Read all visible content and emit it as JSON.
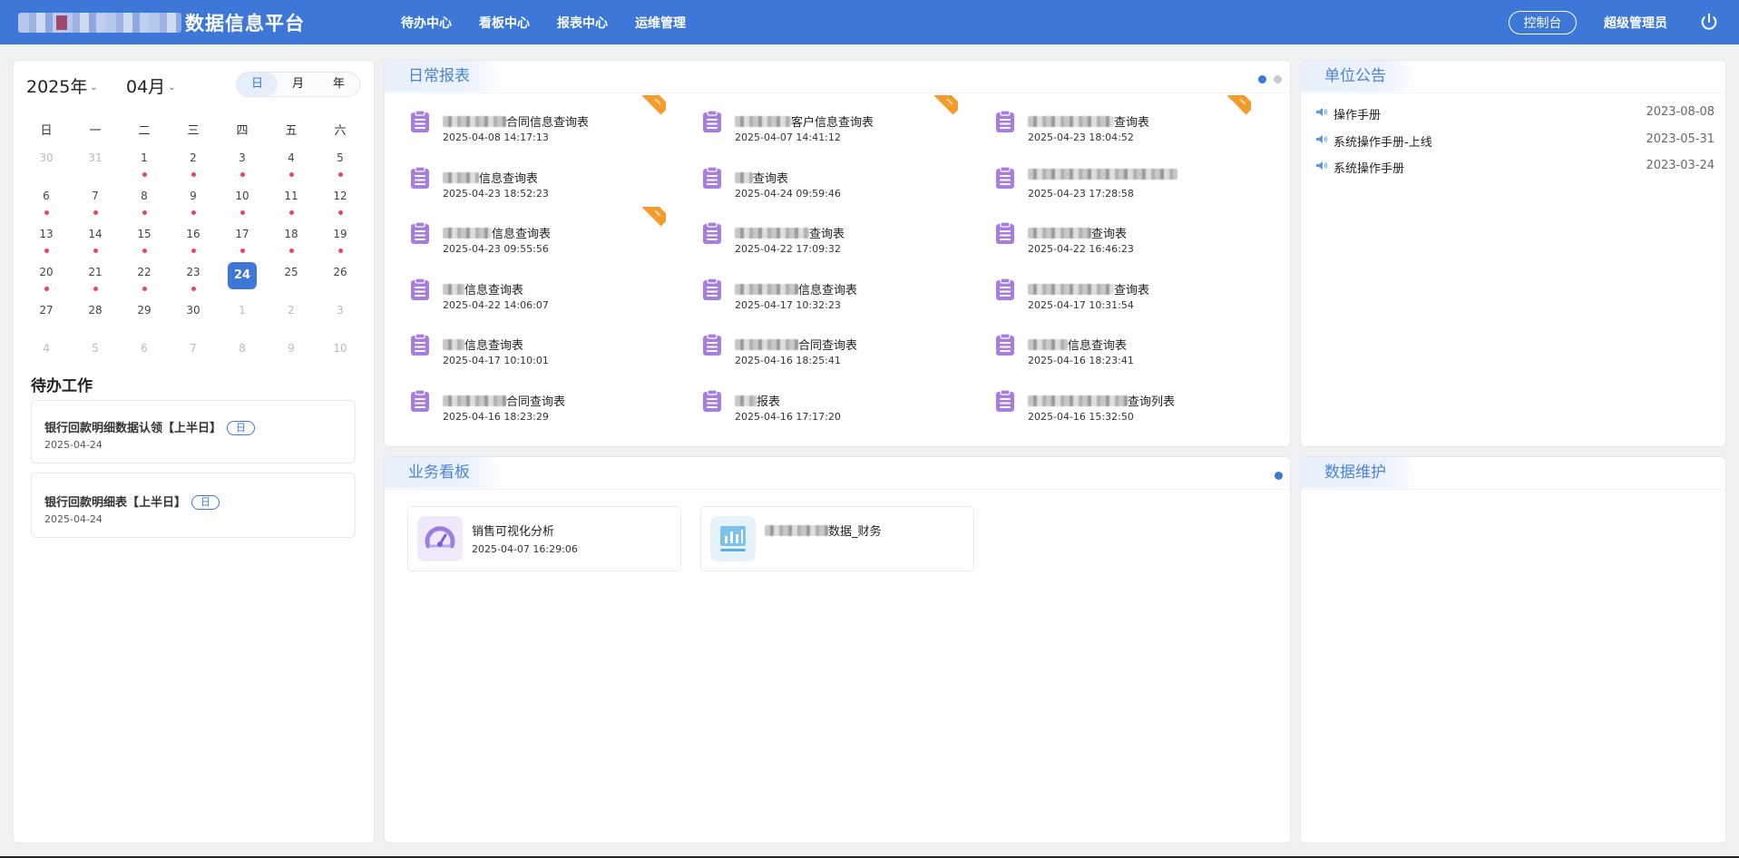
{
  "header": {
    "brand_text": "数据信息平台",
    "nav": [
      "待办中心",
      "看板中心",
      "报表中心",
      "运维管理"
    ],
    "console_label": "控制台",
    "user": "超级管理员",
    "accent": "#3d78d8"
  },
  "calendar": {
    "year": "2025年",
    "month": "04月",
    "views": [
      "日",
      "月",
      "年"
    ],
    "active_view": "日",
    "weekdays": [
      "日",
      "一",
      "二",
      "三",
      "四",
      "五",
      "六"
    ],
    "days": [
      {
        "n": "30",
        "muted": true,
        "dot": false
      },
      {
        "n": "31",
        "muted": true,
        "dot": false
      },
      {
        "n": "1",
        "dot": true
      },
      {
        "n": "2",
        "dot": true
      },
      {
        "n": "3",
        "dot": true
      },
      {
        "n": "4",
        "dot": true
      },
      {
        "n": "5",
        "dot": true
      },
      {
        "n": "6",
        "dot": true
      },
      {
        "n": "7",
        "dot": true
      },
      {
        "n": "8",
        "dot": true
      },
      {
        "n": "9",
        "dot": true
      },
      {
        "n": "10",
        "dot": true
      },
      {
        "n": "11",
        "dot": true
      },
      {
        "n": "12",
        "dot": true
      },
      {
        "n": "13",
        "dot": true
      },
      {
        "n": "14",
        "dot": true
      },
      {
        "n": "15",
        "dot": true
      },
      {
        "n": "16",
        "dot": true
      },
      {
        "n": "17",
        "dot": true
      },
      {
        "n": "18",
        "dot": true
      },
      {
        "n": "19",
        "dot": true
      },
      {
        "n": "20",
        "dot": true
      },
      {
        "n": "21",
        "dot": true
      },
      {
        "n": "22",
        "dot": true
      },
      {
        "n": "23",
        "dot": true
      },
      {
        "n": "24",
        "dot": false,
        "today": true
      },
      {
        "n": "25",
        "dot": false
      },
      {
        "n": "26",
        "dot": false
      },
      {
        "n": "27",
        "dot": false
      },
      {
        "n": "28",
        "dot": false
      },
      {
        "n": "29",
        "dot": false
      },
      {
        "n": "30",
        "dot": false
      },
      {
        "n": "1",
        "muted": true
      },
      {
        "n": "2",
        "muted": true
      },
      {
        "n": "3",
        "muted": true
      },
      {
        "n": "4",
        "muted": true
      },
      {
        "n": "5",
        "muted": true
      },
      {
        "n": "6",
        "muted": true
      },
      {
        "n": "7",
        "muted": true
      },
      {
        "n": "8",
        "muted": true
      },
      {
        "n": "9",
        "muted": true
      },
      {
        "n": "10",
        "muted": true
      }
    ]
  },
  "todo": {
    "title": "待办工作",
    "items": [
      {
        "title": "银行回款明细数据认领【上半日】",
        "tag": "日",
        "date": "2025-04-24"
      },
      {
        "title": "银行回款明细表【上半日】",
        "tag": "日",
        "date": "2025-04-24"
      }
    ]
  },
  "daily_reports": {
    "title": "日常报表",
    "items": [
      {
        "suffix": "合同信息查询表",
        "blur": 70,
        "date": "2025-04-08 14:17:13",
        "new": true
      },
      {
        "suffix": "客户信息查询表",
        "blur": 62,
        "date": "2025-04-07 14:41:12",
        "new": true
      },
      {
        "suffix": "查询表",
        "blur": 95,
        "date": "2025-04-23 18:04:52",
        "new": true
      },
      {
        "suffix": "信息查询表",
        "blur": 40,
        "date": "2025-04-23 18:52:23",
        "new": true
      },
      {
        "suffix": "查询表",
        "blur": 20,
        "date": "2025-04-24 09:59:46",
        "new": false
      },
      {
        "suffix": "",
        "blur": 165,
        "date": "2025-04-23 17:28:58",
        "new": false
      },
      {
        "suffix": "信息查询表",
        "blur": 54,
        "date": "2025-04-23 09:55:56",
        "new": false
      },
      {
        "suffix": "查询表",
        "blur": 82,
        "date": "2025-04-22 17:09:32",
        "new": false
      },
      {
        "suffix": "查询表",
        "blur": 70,
        "date": "2025-04-22 16:46:23",
        "new": false
      },
      {
        "suffix": "信息查询表",
        "blur": 24,
        "date": "2025-04-22 14:06:07",
        "new": false
      },
      {
        "suffix": "信息查询表",
        "blur": 70,
        "date": "2025-04-17 10:32:23",
        "new": false
      },
      {
        "suffix": "查询表",
        "blur": 95,
        "date": "2025-04-17 10:31:54",
        "new": false
      },
      {
        "suffix": "信息查询表",
        "blur": 24,
        "date": "2025-04-17 10:10:01",
        "new": false
      },
      {
        "suffix": "合同查询表",
        "blur": 70,
        "date": "2025-04-16 18:25:41",
        "new": false
      },
      {
        "suffix": "信息查询表",
        "blur": 44,
        "date": "2025-04-16 18:23:41",
        "new": false
      },
      {
        "suffix": "合同查询表",
        "blur": 70,
        "date": "2025-04-16 18:23:29",
        "new": false
      },
      {
        "suffix": "报表",
        "blur": 24,
        "date": "2025-04-16 17:17:20",
        "new": false
      },
      {
        "suffix": "查询列表",
        "blur": 110,
        "date": "2025-04-16 15:32:50",
        "new": false
      }
    ]
  },
  "announcements": {
    "title": "单位公告",
    "items": [
      {
        "text": "操作手册",
        "date": "2023-08-08"
      },
      {
        "text": "系统操作手册-上线",
        "date": "2023-05-31"
      },
      {
        "text": "系统操作手册",
        "date": "2023-03-24"
      }
    ]
  },
  "board": {
    "title": "业务看板",
    "items": [
      {
        "name": "销售可视化分析",
        "date": "2025-04-07 16:29:06",
        "icon": "dashboard-gauge-icon"
      },
      {
        "name": "数据_财务",
        "blur": 70,
        "date": "",
        "icon": "bar-chart-icon"
      }
    ]
  },
  "maintenance": {
    "title": "数据维护"
  }
}
